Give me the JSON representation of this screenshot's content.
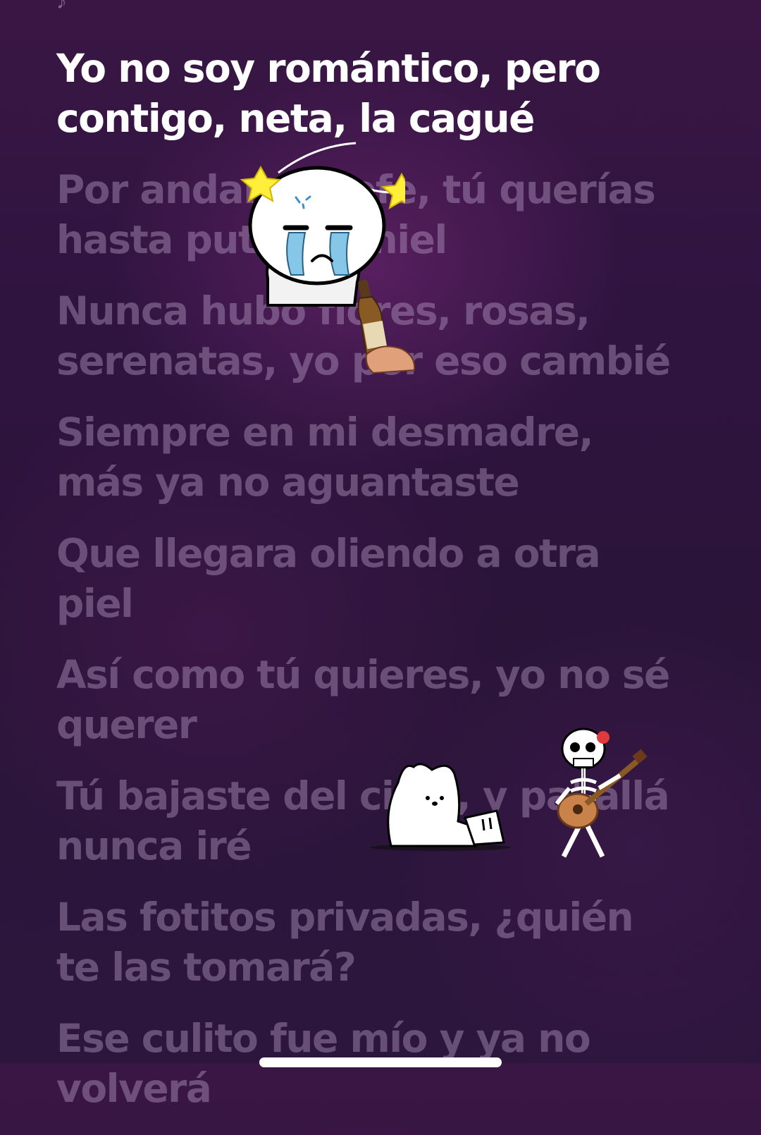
{
  "player": {
    "note_icon": "music-note-icon",
    "lyrics": [
      {
        "text": "Yo no soy romántico, pero contigo, neta, la cagué",
        "active": true
      },
      {
        "text": "Por andar de jefe, tú querías hasta puta de miel",
        "active": false
      },
      {
        "text": "Nunca hubo flores, rosas, serenatas, yo por eso cambié",
        "active": false
      },
      {
        "text": "Siempre en mi desmadre, más ya no aguantaste",
        "active": false
      },
      {
        "text": "Que llegara oliendo a otra piel",
        "active": false
      },
      {
        "text": "Así como tú quieres, yo no sé querer",
        "active": false
      },
      {
        "text": "Tú bajaste del cielo, y pa' allá nunca iré",
        "active": false
      },
      {
        "text": "Las fotitos privadas, ¿quién te las tomará?",
        "active": false
      },
      {
        "text": "Ese culito fue mío y ya no volverá",
        "active": false
      }
    ],
    "stickers": {
      "crying_character": "crying-character-sticker",
      "beer_bottle": "beer-bottle-sticker",
      "bear": "sad-bear-sticker",
      "skeleton": "skeleton-guitar-sticker"
    }
  }
}
